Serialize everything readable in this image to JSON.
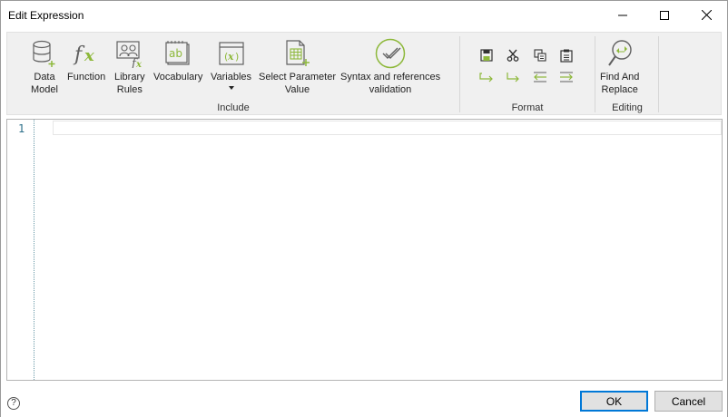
{
  "window": {
    "title": "Edit Expression"
  },
  "ribbon": {
    "groups": {
      "include": "Include",
      "format": "Format",
      "editing": "Editing"
    },
    "tools": {
      "data_model": "Data\nModel",
      "function": "Function",
      "library_rules": "Library\nRules",
      "vocabulary": "Vocabulary",
      "variables": "Variables",
      "select_parameter_value": "Select Parameter\nValue",
      "syntax_validation": "Syntax and references\nvalidation",
      "find_and_replace": "Find And\nReplace"
    }
  },
  "editor": {
    "line_numbers": [
      "1"
    ],
    "content": ""
  },
  "footer": {
    "help": "?",
    "ok": "OK",
    "cancel": "Cancel"
  },
  "colors": {
    "accent_green": "#8db83a",
    "icon_gray": "#606060",
    "line_number": "#2b6f89",
    "ok_border": "#0078d7"
  }
}
